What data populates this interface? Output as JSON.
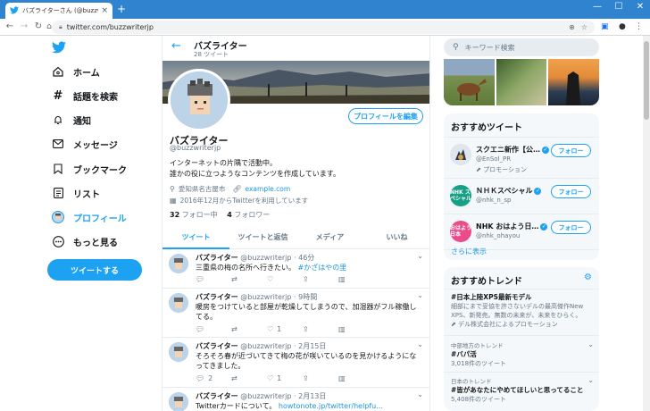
{
  "browser": {
    "tab_title": "バズライターさん (@buzzwriterjp) / T",
    "url": "twitter.com/buzzwriterjp",
    "new_tab": "+",
    "minimize": "—",
    "maximize": "☐",
    "close": "✕"
  },
  "nav": {
    "items": [
      {
        "label": "ホーム",
        "icon": "home-icon"
      },
      {
        "label": "話題を検索",
        "icon": "hashtag-icon"
      },
      {
        "label": "通知",
        "icon": "bell-icon"
      },
      {
        "label": "メッセージ",
        "icon": "mail-icon"
      },
      {
        "label": "ブックマーク",
        "icon": "bookmark-icon"
      },
      {
        "label": "リスト",
        "icon": "list-icon"
      },
      {
        "label": "プロフィール",
        "icon": "profile-avatar-icon"
      },
      {
        "label": "もっと見る",
        "icon": "more-icon"
      }
    ],
    "tweet_button": "ツイートする"
  },
  "profile": {
    "header_name": "バズライター",
    "header_count": "28 ツイート",
    "edit_button": "プロフィールを編集",
    "name": "バズライター",
    "handle": "@buzzwriterjp",
    "bio_line1": "インターネットの片隅で活動中。",
    "bio_line2": "誰かの役に立つようなコンテンツを作成しています。",
    "location": "愛知県名古屋市",
    "website": "example.com",
    "joined": "2016年12月からTwitterを利用しています",
    "following_count": "32",
    "following_label": "フォロー中",
    "followers_count": "4",
    "followers_label": "フォロワー"
  },
  "tabs": [
    "ツイート",
    "ツイートと返信",
    "メディア",
    "いいね"
  ],
  "tweets": [
    {
      "name": "バズライター",
      "handle": "@buzzwriterjp",
      "time": "46分",
      "text": "三重県の梅の名所へ行きたい。",
      "hashtag": "#かざはやの里",
      "reply": "",
      "retweet": "",
      "like": ""
    },
    {
      "name": "バズライター",
      "handle": "@buzzwriterjp",
      "time": "9時間",
      "text": "暖房をつけていると部屋が乾燥してしまうので、加湿器がフル稼働してる。",
      "reply": "",
      "retweet": "",
      "like": "1"
    },
    {
      "name": "バズライター",
      "handle": "@buzzwriterjp",
      "time": "2月15日",
      "text": "そろそろ春が近づいてきて梅の花が咲いているのを見かけるようになってきました。",
      "reply": "2",
      "retweet": "",
      "like": "1"
    },
    {
      "name": "バズライター",
      "handle": "@buzzwriterjp",
      "time": "2月13日",
      "text": "Twitterカードについて。",
      "link": "howtonote.jp/twitter/helpfu..."
    }
  ],
  "right": {
    "search_placeholder": "キーワード検索",
    "rec_title": "おすすめツイート",
    "recommendations": [
      {
        "name": "スクエニ新作【公…",
        "handle": "@EnSol_PR",
        "promo": "プロモーション",
        "follow": "フォロー"
      },
      {
        "name": "ＮＨＫスペシャル",
        "handle": "@nhk_n_sp",
        "follow": "フォロー",
        "avatar_text": "NHK スペシャル"
      },
      {
        "name": "NHK おはよう日…",
        "handle": "@nhk_ohayou",
        "follow": "フォロー",
        "avatar_text": "おはよう 日本"
      }
    ],
    "show_more": "さらに表示",
    "trend_title": "おすすめトレンド",
    "trends": [
      {
        "context": "",
        "name": "#日本上陸XPS最新モデル",
        "desc": "細部にまで妥協を許さないデルの最高傑作New XPS、新発売。無数の未来が、未来をひらく。",
        "count": "",
        "promo": "デル株式会社によるプロモーション"
      },
      {
        "context": "中部地方のトレンド",
        "name": "#バパ活",
        "count": "3,018件のツイート"
      },
      {
        "context": "日本のトレンド",
        "name": "#皆があなたにやめてほしいと思ってること",
        "count": "5,408件のツイート"
      }
    ]
  },
  "colors": {
    "accent": "#1da1f2",
    "chrome": "#2f83cf"
  }
}
